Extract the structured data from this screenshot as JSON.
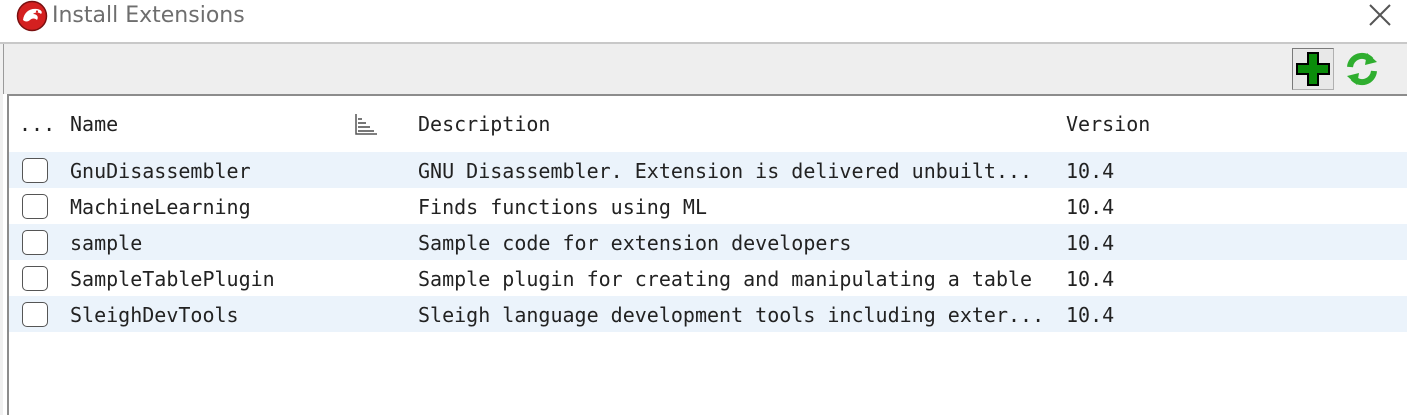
{
  "window": {
    "title": "Install Extensions",
    "icon": "dragon-logo-icon",
    "close_icon": "close-icon"
  },
  "toolbar": {
    "add_icon": "add-icon",
    "refresh_icon": "refresh-icon"
  },
  "table": {
    "columns": {
      "select": "...",
      "name": "Name",
      "description": "Description",
      "version": "Version"
    },
    "rows": [
      {
        "checked": false,
        "name": "GnuDisassembler",
        "description": "GNU Disassembler.  Extension is delivered unbuilt...",
        "version": "10.4"
      },
      {
        "checked": false,
        "name": "MachineLearning",
        "description": "Finds functions using ML",
        "version": "10.4"
      },
      {
        "checked": false,
        "name": "sample",
        "description": "Sample code for extension developers",
        "version": "10.4"
      },
      {
        "checked": false,
        "name": "SampleTablePlugin",
        "description": "Sample plugin for creating and manipulating a table",
        "version": "10.4"
      },
      {
        "checked": false,
        "name": "SleighDevTools",
        "description": "Sleigh language development tools including exter...",
        "version": "10.4"
      }
    ]
  },
  "colors": {
    "row_alt": "#ebf3fb",
    "add_green": "#0a8c0a",
    "refresh_green": "#2fae2f",
    "logo_red": "#d42020"
  }
}
